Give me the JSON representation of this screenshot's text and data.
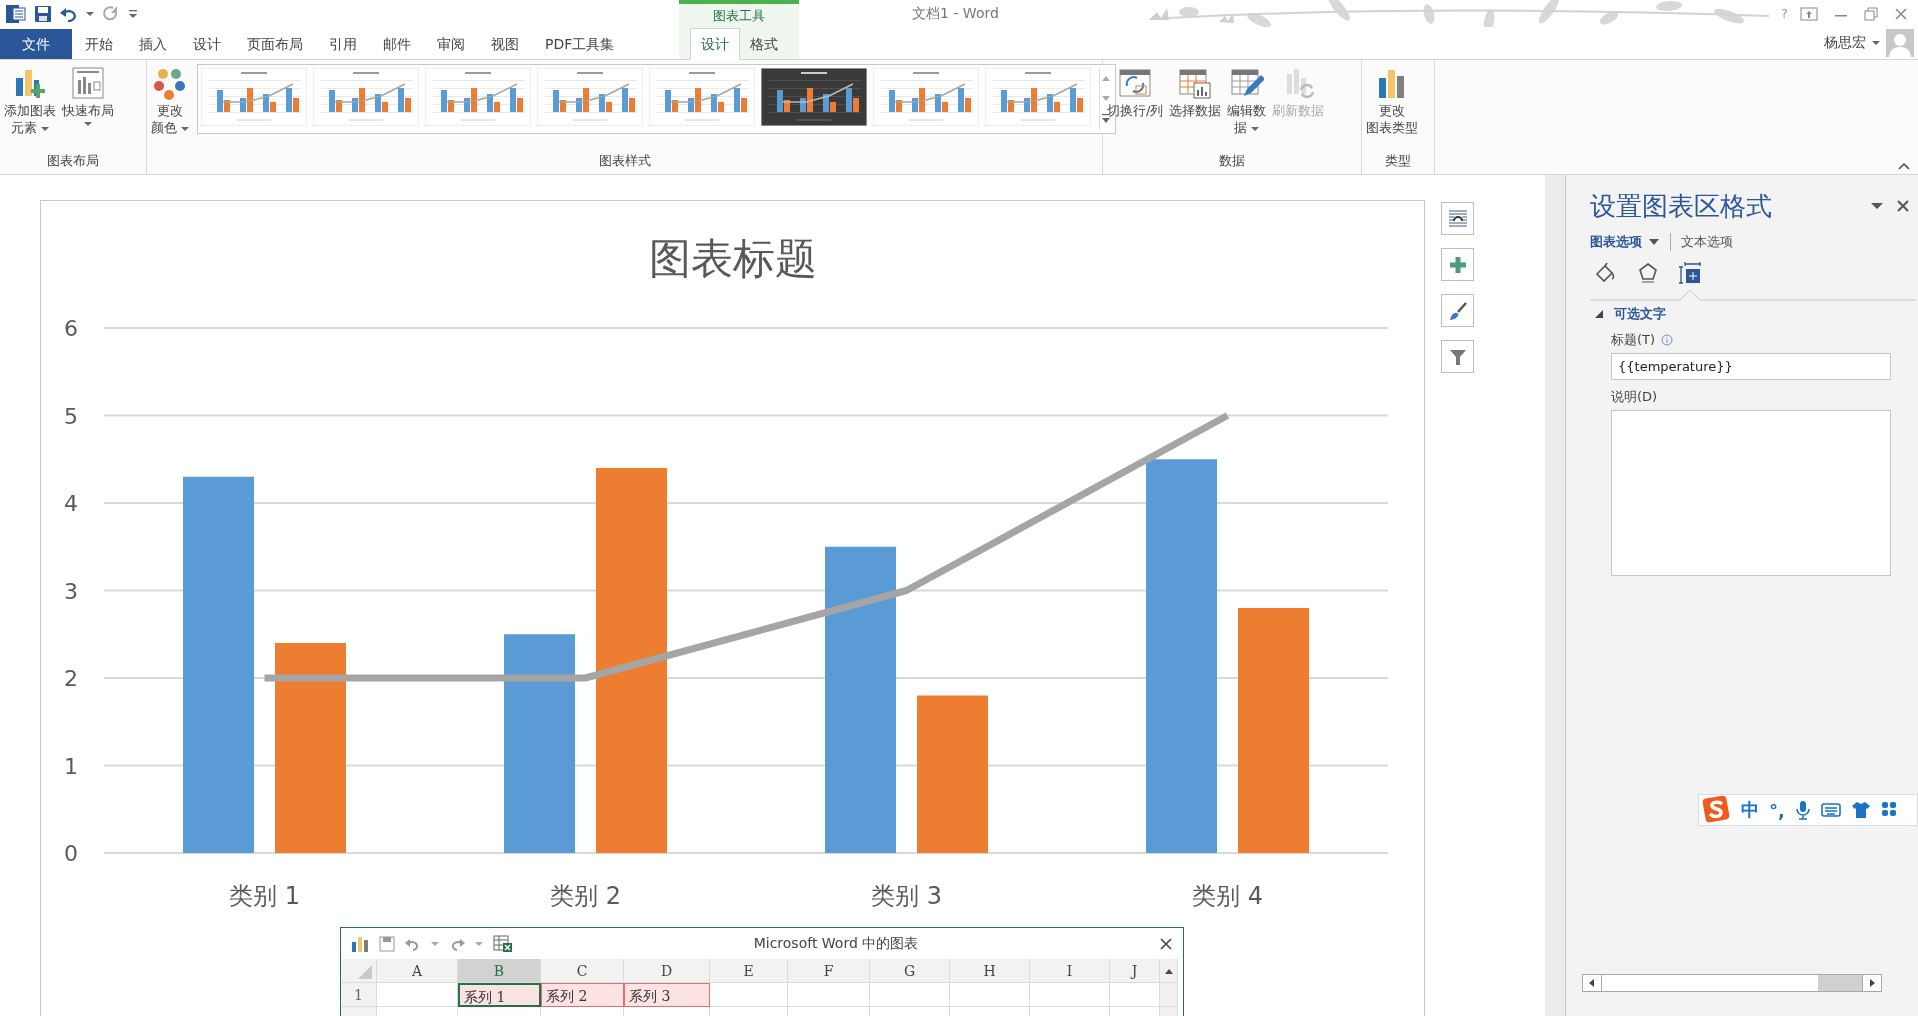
{
  "title_bar": {
    "title": "文档1 - Word",
    "help": "?",
    "user": "杨思宏"
  },
  "contextual_group": {
    "label": "图表工具"
  },
  "tabs": [
    {
      "label": "文件",
      "kind": "file",
      "selected": false
    },
    {
      "label": "开始",
      "kind": "normal",
      "selected": false
    },
    {
      "label": "插入",
      "kind": "normal",
      "selected": false
    },
    {
      "label": "设计",
      "kind": "normal",
      "selected": false
    },
    {
      "label": "页面布局",
      "kind": "normal",
      "selected": false
    },
    {
      "label": "引用",
      "kind": "normal",
      "selected": false
    },
    {
      "label": "邮件",
      "kind": "normal",
      "selected": false
    },
    {
      "label": "审阅",
      "kind": "normal",
      "selected": false
    },
    {
      "label": "视图",
      "kind": "normal",
      "selected": false
    },
    {
      "label": "PDF工具集",
      "kind": "normal",
      "selected": false
    },
    {
      "label": "设计",
      "kind": "context",
      "selected": true
    },
    {
      "label": "格式",
      "kind": "context",
      "selected": false
    }
  ],
  "ribbon": {
    "groups": [
      {
        "label": "图表布局",
        "buttons": [
          {
            "lines": [
              "添加图表",
              "元素"
            ],
            "dropdown": true,
            "disabled": false
          },
          {
            "lines": [
              "快速布局"
            ],
            "dropdown": true,
            "disabled": false
          }
        ]
      },
      {
        "label": "图表样式",
        "buttons": [
          {
            "lines": [
              "更改",
              "颜色"
            ],
            "dropdown": true,
            "disabled": false
          }
        ],
        "gallery": {
          "styles": [
            {
              "kind": "light"
            },
            {
              "kind": "light"
            },
            {
              "kind": "light"
            },
            {
              "kind": "light"
            },
            {
              "kind": "light"
            },
            {
              "kind": "dark"
            },
            {
              "kind": "light"
            },
            {
              "kind": "light"
            }
          ]
        }
      },
      {
        "label": "数据",
        "buttons": [
          {
            "lines": [
              "切换行/列"
            ],
            "dropdown": false,
            "disabled": false
          },
          {
            "lines": [
              "选择数据"
            ],
            "dropdown": false,
            "disabled": false
          },
          {
            "lines": [
              "编辑数",
              "据"
            ],
            "dropdown": true,
            "disabled": false
          },
          {
            "lines": [
              "刷新数据"
            ],
            "dropdown": false,
            "disabled": true
          }
        ]
      },
      {
        "label": "类型",
        "buttons": [
          {
            "lines": [
              "更改",
              "图表类型"
            ],
            "dropdown": false,
            "disabled": false
          }
        ]
      }
    ]
  },
  "chart": {
    "chart_data": {
      "type": "bar",
      "grid": true,
      "title": "图表标题",
      "categories": [
        "类别 1",
        "类别 2",
        "类别 3",
        "类别 4"
      ],
      "ylim": [
        0,
        6
      ],
      "yticks": [
        0,
        1,
        2,
        3,
        4,
        5,
        6
      ],
      "series": [
        {
          "type": "bar",
          "color": "#5b9bd5",
          "values": [
            4.3,
            2.5,
            3.5,
            4.5
          ]
        },
        {
          "type": "bar",
          "color": "#ed7d31",
          "values": [
            2.4,
            4.4,
            1.8,
            2.8
          ]
        },
        {
          "type": "line",
          "color": "#a5a5a5",
          "values": [
            2,
            2,
            3,
            5
          ]
        }
      ]
    }
  },
  "data_window": {
    "title": "Microsoft Word 中的图表",
    "columns": [
      {
        "label": "A",
        "selected": false
      },
      {
        "label": "B",
        "selected": true
      },
      {
        "label": "C",
        "selected": false
      },
      {
        "label": "D",
        "selected": false
      },
      {
        "label": "E",
        "selected": false
      },
      {
        "label": "F",
        "selected": false
      },
      {
        "label": "G",
        "selected": false
      },
      {
        "label": "H",
        "selected": false
      },
      {
        "label": "I",
        "selected": false
      },
      {
        "label": "J",
        "selected": false
      }
    ],
    "rows": [
      {
        "header": "1",
        "cells": [
          {
            "kind": "empty"
          },
          {
            "kind": "series",
            "text": "系列 1",
            "selected": true
          },
          {
            "kind": "series",
            "text": "系列 2",
            "selected": false
          },
          {
            "kind": "series",
            "text": "系列 3",
            "selected": false
          }
        ]
      }
    ]
  },
  "format_pane": {
    "title": "设置图表区格式",
    "option_tabs": [
      {
        "label": "图表选项",
        "selected": true
      },
      {
        "label": "文本选项",
        "selected": false
      }
    ],
    "icon_tabs": [
      {
        "selected": false
      },
      {
        "selected": false
      },
      {
        "selected": true
      }
    ],
    "section": {
      "title": "可选文字",
      "expanded": true,
      "fields": [
        {
          "label": "标题(T)",
          "kind": "single",
          "info": true,
          "value": "{{temperature}}"
        },
        {
          "label": "说明(D)",
          "kind": "multi",
          "info": false
        }
      ]
    }
  },
  "ime_bar": {
    "mode": "中",
    "punctuation": "°,"
  }
}
